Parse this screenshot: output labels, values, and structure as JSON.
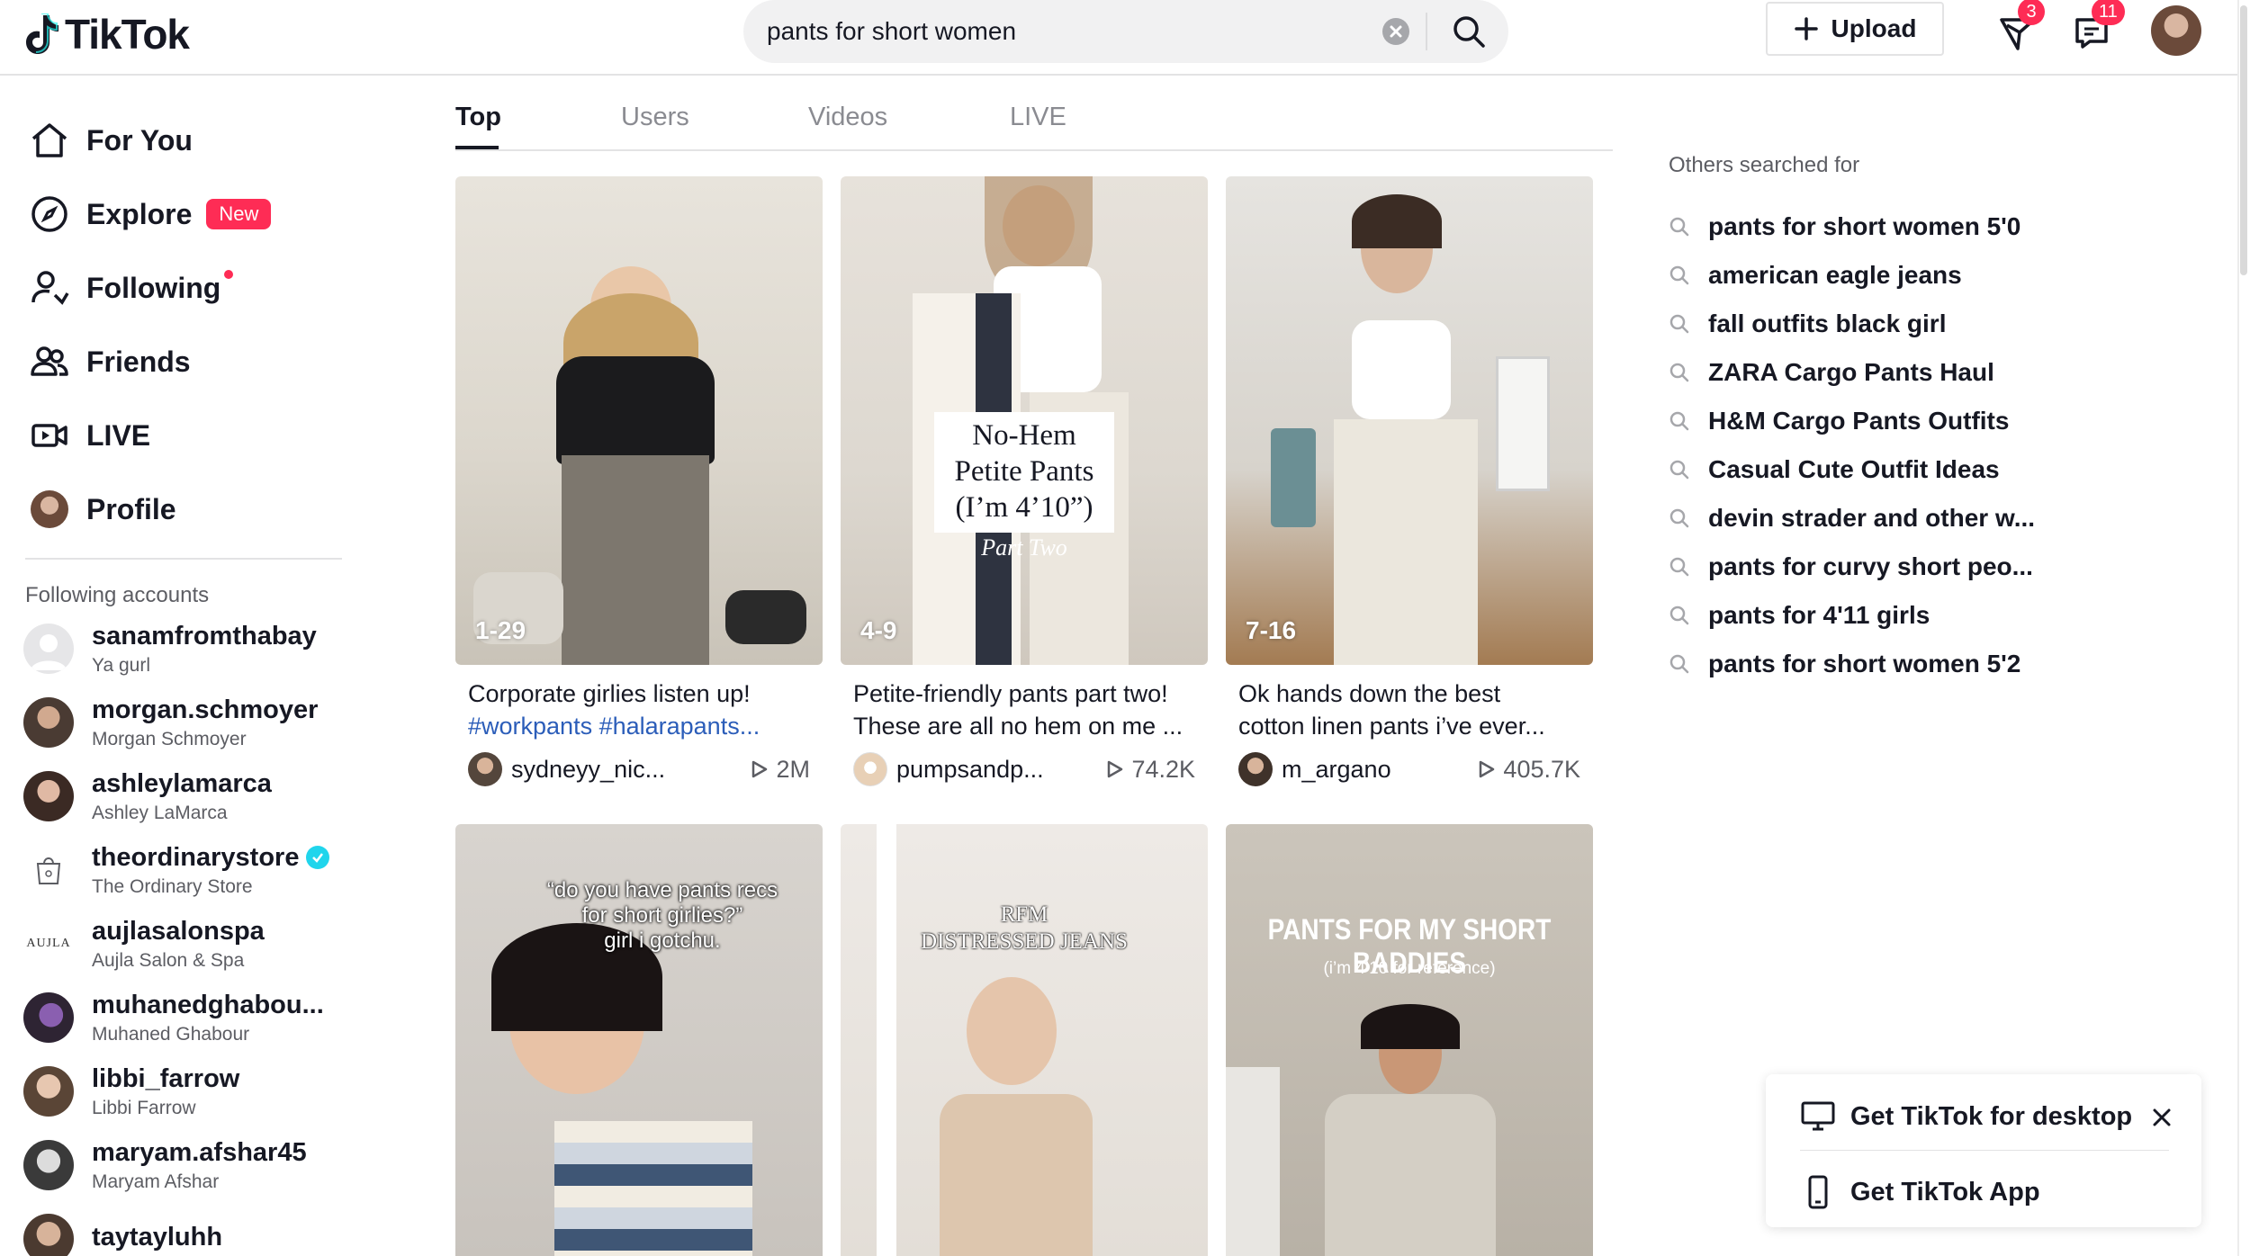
{
  "header": {
    "logo_text": "TikTok",
    "search_value": "pants for short women",
    "upload_label": "Upload",
    "inbox_badge": "3",
    "messages_badge": "11"
  },
  "sidebar": {
    "nav": [
      {
        "label": "For You",
        "icon": "home-icon"
      },
      {
        "label": "Explore",
        "icon": "compass-icon",
        "badge": "New"
      },
      {
        "label": "Following",
        "icon": "following-icon"
      },
      {
        "label": "Friends",
        "icon": "friends-icon"
      },
      {
        "label": "LIVE",
        "icon": "live-icon"
      },
      {
        "label": "Profile",
        "icon": "avatar"
      }
    ],
    "following_title": "Following accounts",
    "accounts": [
      {
        "user": "sanamfromthabay",
        "name": "Ya gurl"
      },
      {
        "user": "morgan.schmoyer",
        "name": "Morgan Schmoyer"
      },
      {
        "user": "ashleylamarca",
        "name": "Ashley LaMarca"
      },
      {
        "user": "theordinarystore",
        "name": "The Ordinary Store"
      },
      {
        "user": "aujlasalonspa",
        "name": "Aujla Salon & Spa"
      },
      {
        "user": "muhanedghabou...",
        "name": "Muhaned Ghabour"
      },
      {
        "user": "libbi_farrow",
        "name": "Libbi Farrow"
      },
      {
        "user": "maryam.afshar45",
        "name": "Maryam Afshar"
      },
      {
        "user": "taytayluhh",
        "name": ""
      }
    ],
    "aujla_logo_text": "AUJLA"
  },
  "tabs": [
    "Top",
    "Users",
    "Videos",
    "LIVE"
  ],
  "videos": [
    {
      "range": "1-29",
      "desc1": "Corporate girlies listen up!",
      "desc2": "#workpants #halarapants...",
      "user": "sydneyy_nic...",
      "views": "2M"
    },
    {
      "range": "4-9",
      "desc1": "Petite-friendly pants part two!",
      "desc2": "These are all no hem on me ...",
      "user": "pumpsandp...",
      "views": "74.2K",
      "overlay1": "No-Hem",
      "overlay2": "Petite Pants",
      "overlay3": "(I’m 4’10”)",
      "overlay4": "Part Two"
    },
    {
      "range": "7-16",
      "desc1": "Ok hands down the best",
      "desc2": "cotton linen pants i’ve ever...",
      "user": "m_argano",
      "views": "405.7K"
    },
    {
      "overlay1": "“do you have pants recs",
      "overlay2": "for short girlies?”",
      "overlay3": "girl i gotchu."
    },
    {
      "overlay1": "RFM",
      "overlay2": "DISTRESSED JEANS"
    },
    {
      "overlay1": "PANTS FOR MY SHORT BADDIES",
      "overlay2": "(i’m 4’10 for reference)"
    }
  ],
  "others": {
    "title": "Others searched for",
    "items": [
      "pants for short women 5'0",
      "american eagle jeans",
      "fall outfits black girl",
      "ZARA Cargo Pants Haul",
      "H&M Cargo Pants Outfits",
      "Casual Cute Outfit Ideas",
      "devin strader and other w...",
      "pants for curvy short peo...",
      "pants for 4'11 girls",
      "pants for short women 5'2"
    ]
  },
  "popup": {
    "desktop_label": "Get TikTok for desktop",
    "app_label": "Get TikTok App"
  }
}
